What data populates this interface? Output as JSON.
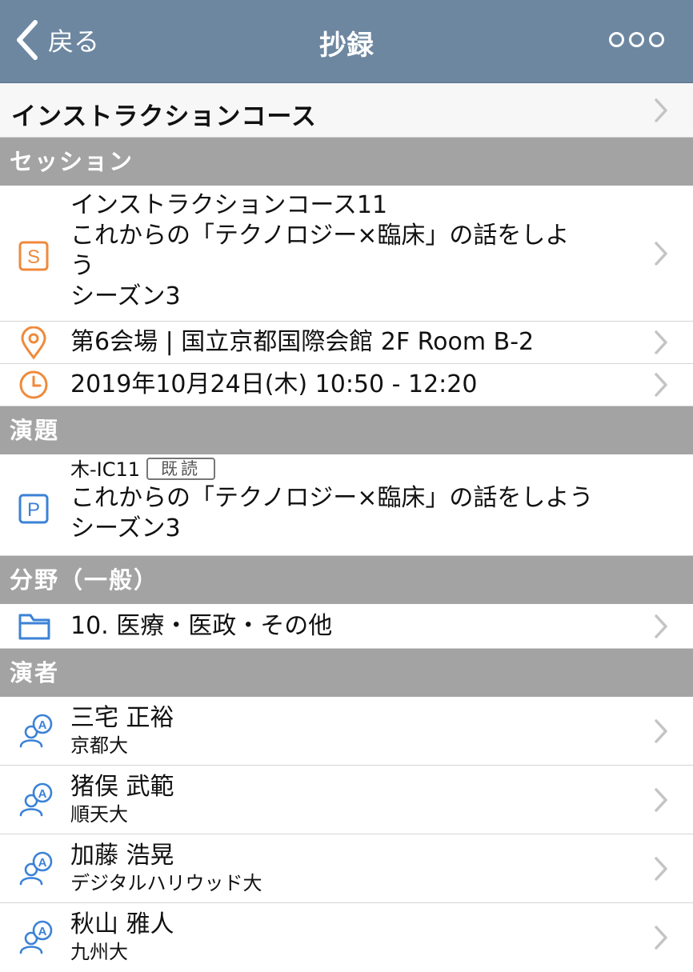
{
  "nav": {
    "back_label": "戻る",
    "title": "抄録"
  },
  "course": {
    "title": "インストラクションコース"
  },
  "sections": {
    "session": "セッション",
    "topic": "演題",
    "field": "分野（一般）",
    "speakers": "演者"
  },
  "session": {
    "title_lines": [
      "インストラクションコース11",
      "これからの「テクノロジー×臨床」の話をしよ",
      "う",
      "シーズン3"
    ],
    "venue": "第6会場 | 国立京都国際会館 2F Room B-2",
    "datetime": "2019年10月24日(木)  10:50 - 12:20"
  },
  "topic": {
    "code": "木-IC11",
    "read_badge": "既読",
    "title_lines": [
      "これからの「テクノロジー×臨床」の話をしよう",
      "シーズン3"
    ]
  },
  "field": {
    "label": "10. 医療・医政・その他"
  },
  "speakers": [
    {
      "name": "三宅 正裕",
      "affiliation": "京都大"
    },
    {
      "name": "猪俣 武範",
      "affiliation": "順天大"
    },
    {
      "name": "加藤 浩晃",
      "affiliation": "デジタルハリウッド大"
    },
    {
      "name": "秋山 雅人",
      "affiliation": "九州大"
    }
  ],
  "colors": {
    "navbar": "#6d87a1",
    "section_header": "#a3a3a3",
    "session_icon": "#ef8a3c",
    "topic_icon": "#3b82d6"
  },
  "icons": {
    "back": "chevron-left-icon",
    "more": "more-dots-icon",
    "session": "session-s-icon",
    "location": "location-pin-icon",
    "time": "clock-icon",
    "topic": "presentation-p-icon",
    "field": "folder-icon",
    "speaker": "speaker-person-icon",
    "disclosure": "chevron-right-icon"
  }
}
